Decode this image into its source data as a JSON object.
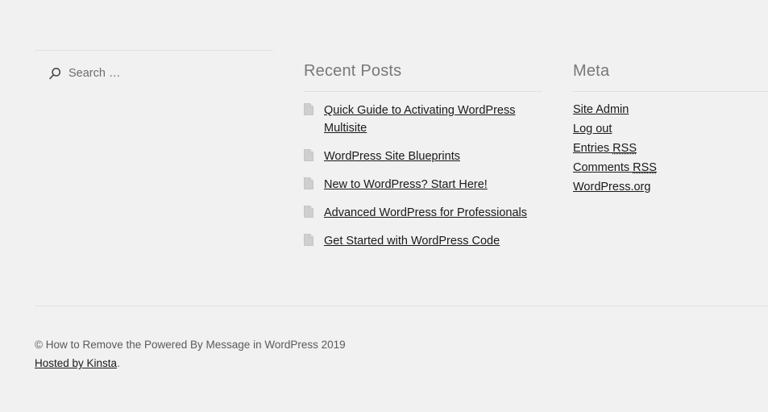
{
  "theme": {
    "background_color": "#f1f1f1",
    "heading_color": "#787878",
    "link_color": "#1a1a1a",
    "text_color": "#5a5a5a",
    "rule_color": "#e0e0e0"
  },
  "search_widget": {
    "icon": "search-icon",
    "placeholder": "Search …",
    "value": ""
  },
  "recent_posts_widget": {
    "title": "Recent Posts",
    "item_icon": "document-icon",
    "items": [
      {
        "label": "Quick Guide to Activating WordPress Multisite"
      },
      {
        "label": "WordPress Site Blueprints"
      },
      {
        "label": "New to WordPress? Start Here!"
      },
      {
        "label": "Advanced WordPress for Professionals"
      },
      {
        "label": "Get Started with WordPress Code"
      }
    ]
  },
  "meta_widget": {
    "title": "Meta",
    "items": [
      {
        "label": "Site Admin",
        "abbr": ""
      },
      {
        "label": "Log out",
        "abbr": ""
      },
      {
        "label": "Entries ",
        "abbr": "RSS"
      },
      {
        "label": "Comments ",
        "abbr": "RSS"
      },
      {
        "label": "WordPress.org",
        "abbr": ""
      }
    ]
  },
  "footer": {
    "copyright": "© How to Remove the Powered By Message in WordPress 2019",
    "host_link": "Hosted by Kinsta",
    "host_suffix": "."
  }
}
